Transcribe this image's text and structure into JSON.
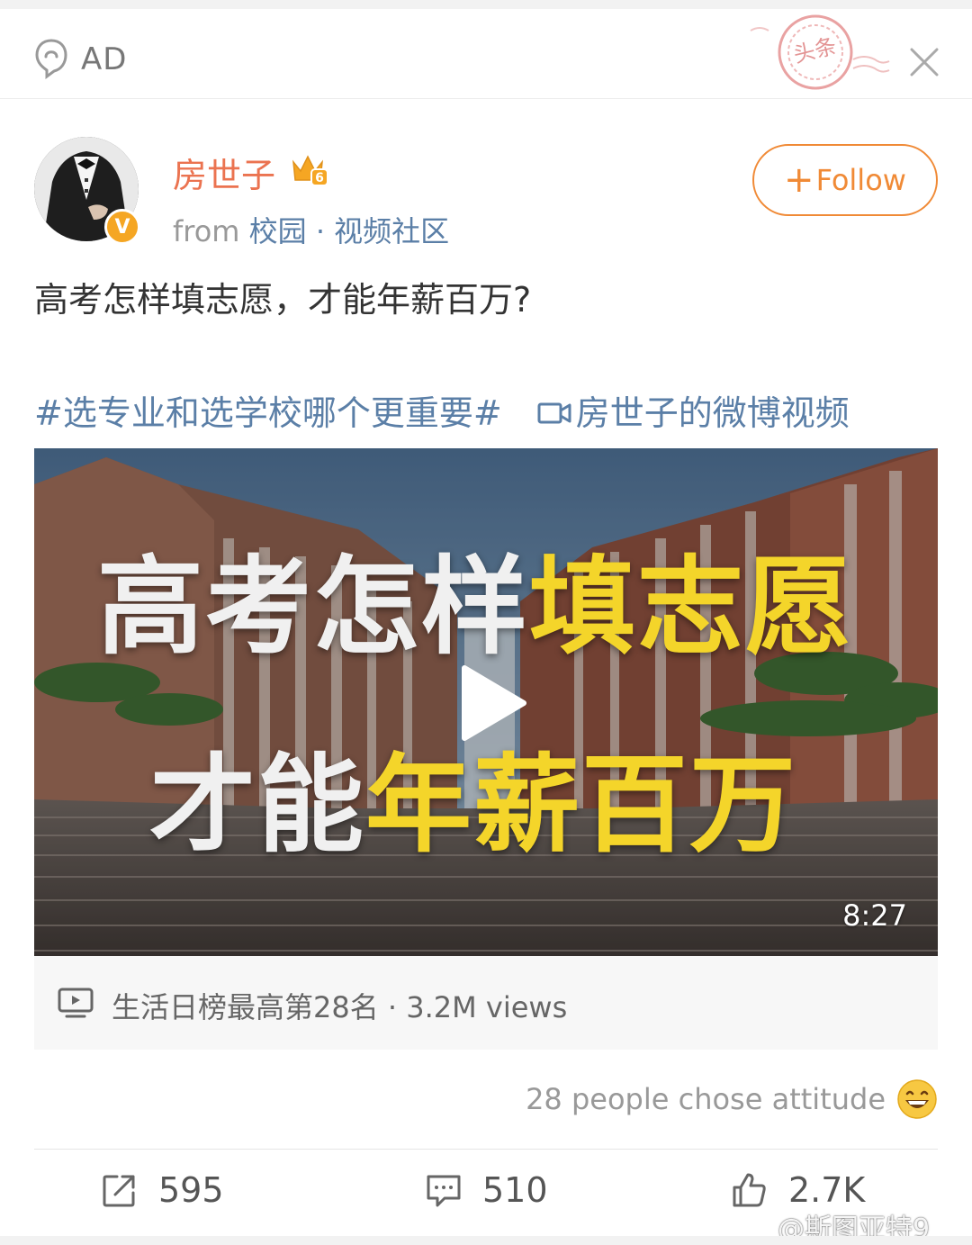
{
  "ad": {
    "label": "AD"
  },
  "stamp": {
    "text": "头条"
  },
  "author": {
    "name": "房世子",
    "from_prefix": "from",
    "source_links": "校园 · 视频社区",
    "follow_label": "Follow",
    "follow_plus": "+",
    "verified_badge": "V",
    "member_level": "6"
  },
  "post": {
    "text": "高考怎样填志愿，才能年薪百万?",
    "topic": "#选专业和选学校哪个更重要#",
    "video_link": "房世子的微博视频"
  },
  "video": {
    "line1_white": "高考怎样",
    "line1_yellow": "填志愿",
    "line2_white": "才能",
    "line2_yellow": "年薪百万",
    "duration": "8:27",
    "info": "生活日榜最高第28名 · 3.2M views"
  },
  "attitude": {
    "text": "28 people chose attitude"
  },
  "actions": {
    "repost": "595",
    "comments": "510",
    "likes": "2.7K"
  },
  "watermark": "@斯图亚特9",
  "colors": {
    "orange": "#eb7350",
    "link_blue": "#5b7fa7",
    "follow": "#f08a36",
    "title_yellow": "#f4d52a"
  }
}
